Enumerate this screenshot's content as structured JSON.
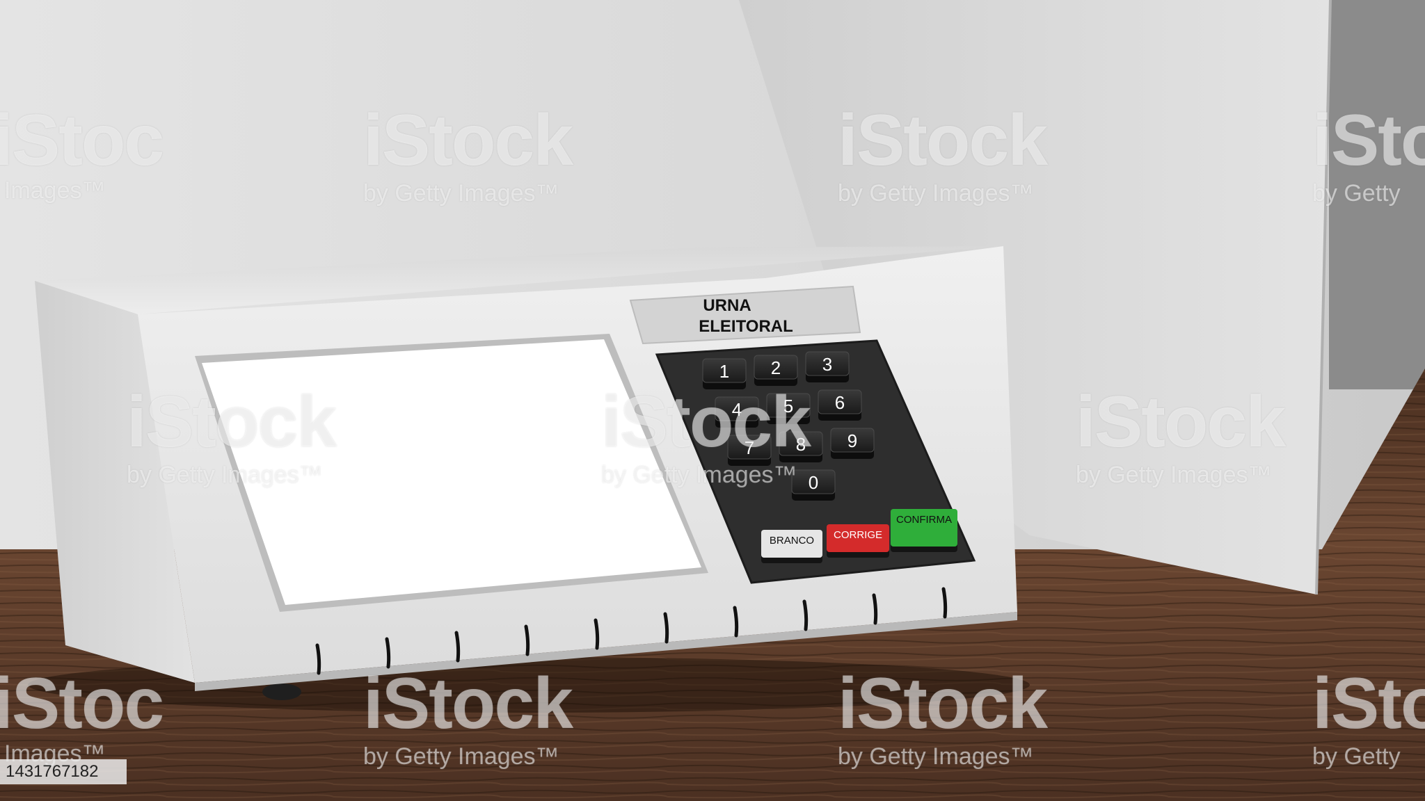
{
  "ballot_box": {
    "label_line1": "URNA",
    "label_line2": "ELEITORAL",
    "keys": [
      {
        "label": "1",
        "row": 0,
        "col": 0
      },
      {
        "label": "2",
        "row": 0,
        "col": 1
      },
      {
        "label": "3",
        "row": 0,
        "col": 2
      },
      {
        "label": "4",
        "row": 1,
        "col": 0
      },
      {
        "label": "5",
        "row": 1,
        "col": 1
      },
      {
        "label": "6",
        "row": 1,
        "col": 2
      },
      {
        "label": "7",
        "row": 2,
        "col": 0
      },
      {
        "label": "8",
        "row": 2,
        "col": 1
      },
      {
        "label": "9",
        "row": 2,
        "col": 2
      },
      {
        "label": "0",
        "row": 3,
        "col": 1
      }
    ],
    "action_keys": [
      {
        "label": "BRANCO",
        "color": "#e6e6e6",
        "text_color": "#111111"
      },
      {
        "label": "CORRIGE",
        "color": "#d42b2b",
        "text_color": "#ffffff"
      },
      {
        "label": "CONFIRMA",
        "color": "#2fae3a",
        "text_color": "#111111"
      }
    ]
  },
  "watermark": {
    "brand": "iStock",
    "credit": "by Getty Images™",
    "brand_partial": "iStoc",
    "credit_partial": "Images™",
    "credit_partial_right": "by Getty"
  },
  "stock_id": "1431767182",
  "colors": {
    "wall": "#dcdcdc",
    "table": "#5a3a28",
    "device_body": "#e9e9e9",
    "keypad": "#2d2d2d",
    "screen": "#ffffff"
  }
}
